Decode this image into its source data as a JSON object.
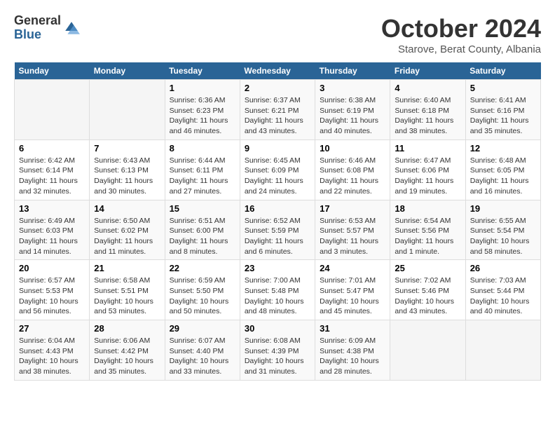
{
  "header": {
    "logo_general": "General",
    "logo_blue": "Blue",
    "month_title": "October 2024",
    "subtitle": "Starove, Berat County, Albania"
  },
  "weekdays": [
    "Sunday",
    "Monday",
    "Tuesday",
    "Wednesday",
    "Thursday",
    "Friday",
    "Saturday"
  ],
  "weeks": [
    [
      {
        "day": "",
        "info": ""
      },
      {
        "day": "",
        "info": ""
      },
      {
        "day": "1",
        "info": "Sunrise: 6:36 AM\nSunset: 6:23 PM\nDaylight: 11 hours and 46 minutes."
      },
      {
        "day": "2",
        "info": "Sunrise: 6:37 AM\nSunset: 6:21 PM\nDaylight: 11 hours and 43 minutes."
      },
      {
        "day": "3",
        "info": "Sunrise: 6:38 AM\nSunset: 6:19 PM\nDaylight: 11 hours and 40 minutes."
      },
      {
        "day": "4",
        "info": "Sunrise: 6:40 AM\nSunset: 6:18 PM\nDaylight: 11 hours and 38 minutes."
      },
      {
        "day": "5",
        "info": "Sunrise: 6:41 AM\nSunset: 6:16 PM\nDaylight: 11 hours and 35 minutes."
      }
    ],
    [
      {
        "day": "6",
        "info": "Sunrise: 6:42 AM\nSunset: 6:14 PM\nDaylight: 11 hours and 32 minutes."
      },
      {
        "day": "7",
        "info": "Sunrise: 6:43 AM\nSunset: 6:13 PM\nDaylight: 11 hours and 30 minutes."
      },
      {
        "day": "8",
        "info": "Sunrise: 6:44 AM\nSunset: 6:11 PM\nDaylight: 11 hours and 27 minutes."
      },
      {
        "day": "9",
        "info": "Sunrise: 6:45 AM\nSunset: 6:09 PM\nDaylight: 11 hours and 24 minutes."
      },
      {
        "day": "10",
        "info": "Sunrise: 6:46 AM\nSunset: 6:08 PM\nDaylight: 11 hours and 22 minutes."
      },
      {
        "day": "11",
        "info": "Sunrise: 6:47 AM\nSunset: 6:06 PM\nDaylight: 11 hours and 19 minutes."
      },
      {
        "day": "12",
        "info": "Sunrise: 6:48 AM\nSunset: 6:05 PM\nDaylight: 11 hours and 16 minutes."
      }
    ],
    [
      {
        "day": "13",
        "info": "Sunrise: 6:49 AM\nSunset: 6:03 PM\nDaylight: 11 hours and 14 minutes."
      },
      {
        "day": "14",
        "info": "Sunrise: 6:50 AM\nSunset: 6:02 PM\nDaylight: 11 hours and 11 minutes."
      },
      {
        "day": "15",
        "info": "Sunrise: 6:51 AM\nSunset: 6:00 PM\nDaylight: 11 hours and 8 minutes."
      },
      {
        "day": "16",
        "info": "Sunrise: 6:52 AM\nSunset: 5:59 PM\nDaylight: 11 hours and 6 minutes."
      },
      {
        "day": "17",
        "info": "Sunrise: 6:53 AM\nSunset: 5:57 PM\nDaylight: 11 hours and 3 minutes."
      },
      {
        "day": "18",
        "info": "Sunrise: 6:54 AM\nSunset: 5:56 PM\nDaylight: 11 hours and 1 minute."
      },
      {
        "day": "19",
        "info": "Sunrise: 6:55 AM\nSunset: 5:54 PM\nDaylight: 10 hours and 58 minutes."
      }
    ],
    [
      {
        "day": "20",
        "info": "Sunrise: 6:57 AM\nSunset: 5:53 PM\nDaylight: 10 hours and 56 minutes."
      },
      {
        "day": "21",
        "info": "Sunrise: 6:58 AM\nSunset: 5:51 PM\nDaylight: 10 hours and 53 minutes."
      },
      {
        "day": "22",
        "info": "Sunrise: 6:59 AM\nSunset: 5:50 PM\nDaylight: 10 hours and 50 minutes."
      },
      {
        "day": "23",
        "info": "Sunrise: 7:00 AM\nSunset: 5:48 PM\nDaylight: 10 hours and 48 minutes."
      },
      {
        "day": "24",
        "info": "Sunrise: 7:01 AM\nSunset: 5:47 PM\nDaylight: 10 hours and 45 minutes."
      },
      {
        "day": "25",
        "info": "Sunrise: 7:02 AM\nSunset: 5:46 PM\nDaylight: 10 hours and 43 minutes."
      },
      {
        "day": "26",
        "info": "Sunrise: 7:03 AM\nSunset: 5:44 PM\nDaylight: 10 hours and 40 minutes."
      }
    ],
    [
      {
        "day": "27",
        "info": "Sunrise: 6:04 AM\nSunset: 4:43 PM\nDaylight: 10 hours and 38 minutes."
      },
      {
        "day": "28",
        "info": "Sunrise: 6:06 AM\nSunset: 4:42 PM\nDaylight: 10 hours and 35 minutes."
      },
      {
        "day": "29",
        "info": "Sunrise: 6:07 AM\nSunset: 4:40 PM\nDaylight: 10 hours and 33 minutes."
      },
      {
        "day": "30",
        "info": "Sunrise: 6:08 AM\nSunset: 4:39 PM\nDaylight: 10 hours and 31 minutes."
      },
      {
        "day": "31",
        "info": "Sunrise: 6:09 AM\nSunset: 4:38 PM\nDaylight: 10 hours and 28 minutes."
      },
      {
        "day": "",
        "info": ""
      },
      {
        "day": "",
        "info": ""
      }
    ]
  ]
}
